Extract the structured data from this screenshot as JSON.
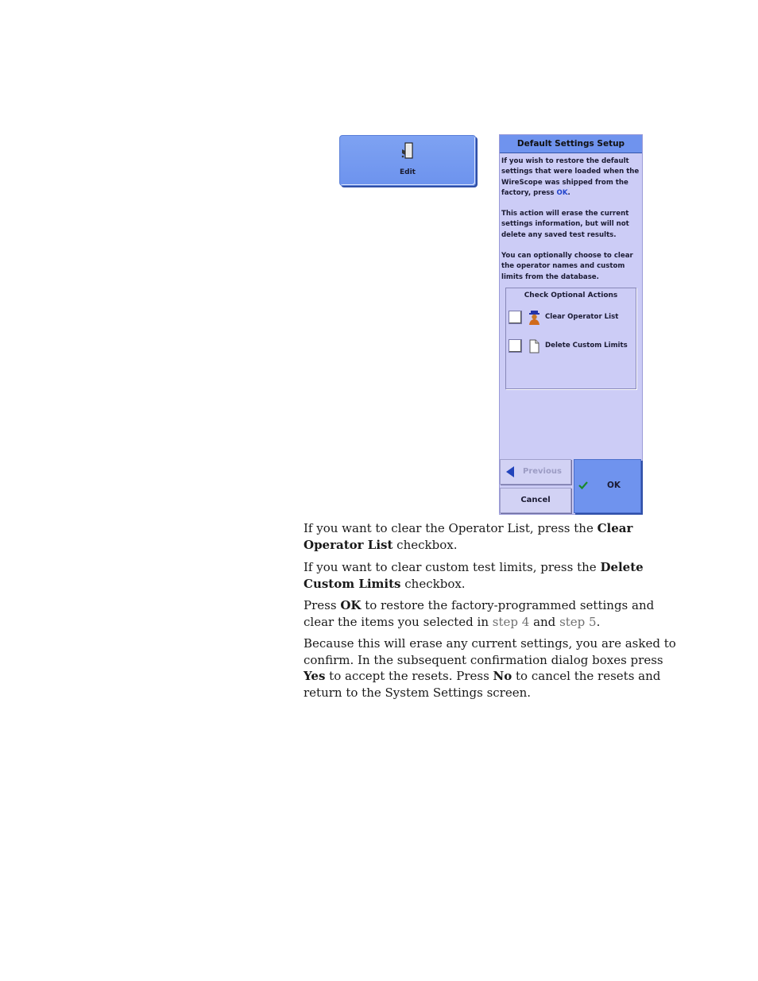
{
  "edit_button": {
    "label": "Edit",
    "icon": "edit-door-icon"
  },
  "dialog": {
    "title": "Default Settings Setup",
    "para1_before": "If you wish to restore the default settings that were loaded when the WireScope was shipped from the factory, press ",
    "para1_ok": "OK",
    "para1_after": ".",
    "para2": "This action will erase the current settings information, but will not delete any saved test results.",
    "para3": "You can optionally choose to clear the operator names and custom limits from the database.",
    "options_title": "Check Optional Actions",
    "options": [
      {
        "label": "Clear Operator List",
        "icon": "operator-person-icon",
        "checked": false
      },
      {
        "label": "Delete Custom Limits",
        "icon": "document-icon",
        "checked": false
      }
    ],
    "previous_label": "Previous",
    "cancel_label": "Cancel",
    "ok_label": "OK"
  },
  "body": {
    "p1_a": "If you want to clear the Operator List, press the ",
    "p1_b": "Clear Operator List",
    "p1_c": " checkbox.",
    "p2_a": "If you want to clear custom test limits, press the ",
    "p2_b": "Delete Custom Limits",
    "p2_c": " checkbox.",
    "p3_a": "Press ",
    "p3_b": "OK",
    "p3_c": " to restore the factory-programmed settings and clear the items you selected in ",
    "p3_ref1": "step 4",
    "p3_d": " and ",
    "p3_ref2": "step 5",
    "p3_e": ".",
    "p4_a": "Because this will erase any current settings, you are asked to confirm. In the subsequent confirmation dialog boxes press ",
    "p4_b": "Yes",
    "p4_c": " to accept the resets. Press ",
    "p4_d": "No",
    "p4_e": " to cancel the resets and return to the System Settings screen."
  },
  "colors": {
    "dialog_bg": "#ccccf6",
    "title_bar": "#6f93ee",
    "link_blue": "#2244cc",
    "cross_ref_gray": "#707070"
  }
}
